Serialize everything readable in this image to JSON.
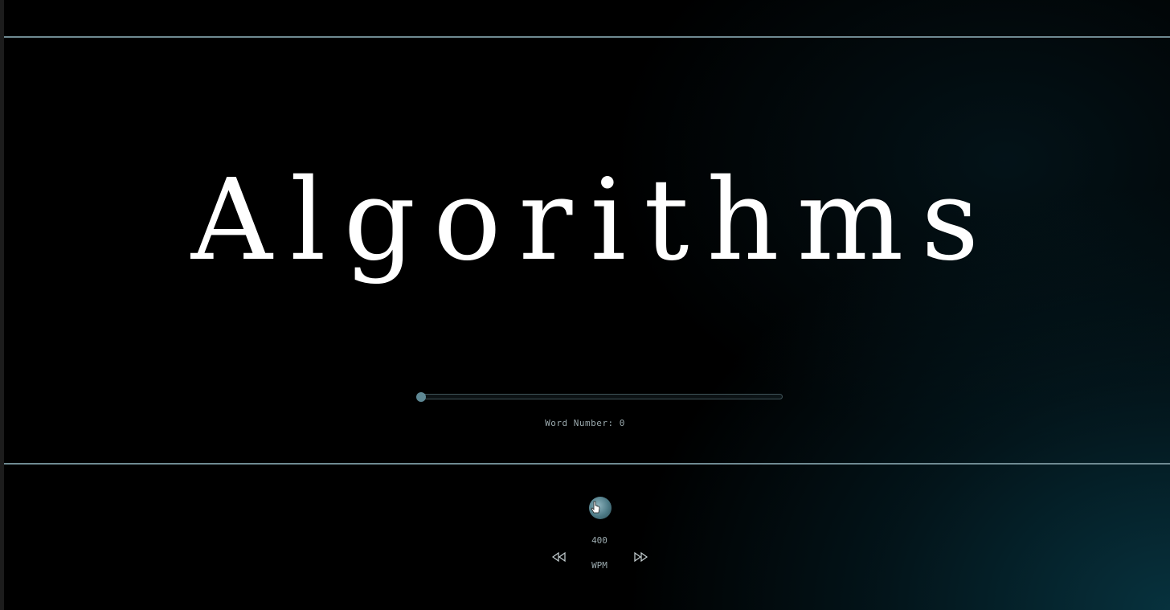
{
  "reader": {
    "current_word": "Algorithms",
    "progress_fraction": 0.0,
    "word_number_label": "Word Number: 0"
  },
  "controls": {
    "wpm_value": "400",
    "wpm_unit": "WPM",
    "play_icon": "play-pause-icon",
    "slower_icon": "rewind-icon",
    "faster_icon": "fast-forward-icon"
  },
  "colors": {
    "accent": "#5e8894",
    "divider": "#6f8a92",
    "text": "#ffffff",
    "muted_text": "#9aa9ad"
  }
}
